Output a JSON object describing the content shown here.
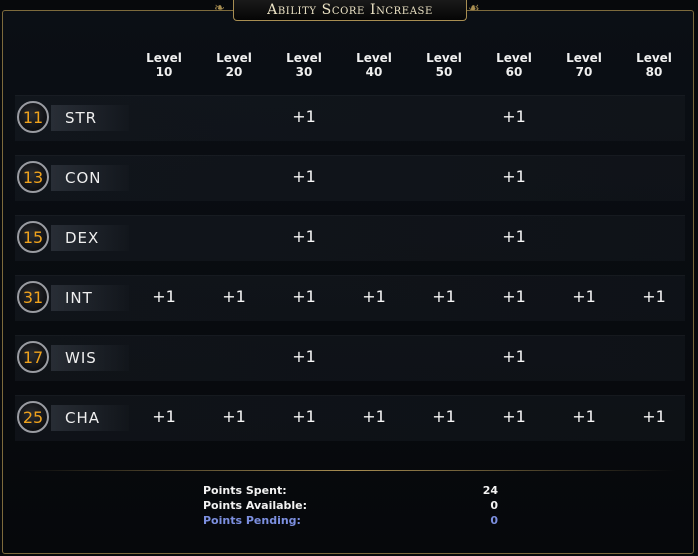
{
  "window": {
    "title": "Ability Score Increase"
  },
  "levels": [
    {
      "label": "Level",
      "num": "10"
    },
    {
      "label": "Level",
      "num": "20"
    },
    {
      "label": "Level",
      "num": "30"
    },
    {
      "label": "Level",
      "num": "40"
    },
    {
      "label": "Level",
      "num": "50"
    },
    {
      "label": "Level",
      "num": "60"
    },
    {
      "label": "Level",
      "num": "70"
    },
    {
      "label": "Level",
      "num": "80"
    }
  ],
  "abilities": [
    {
      "score": "11",
      "abbr": "STR",
      "increases": [
        "",
        "",
        "+1",
        "",
        "",
        "+1",
        "",
        ""
      ]
    },
    {
      "score": "13",
      "abbr": "CON",
      "increases": [
        "",
        "",
        "+1",
        "",
        "",
        "+1",
        "",
        ""
      ]
    },
    {
      "score": "15",
      "abbr": "DEX",
      "increases": [
        "",
        "",
        "+1",
        "",
        "",
        "+1",
        "",
        ""
      ]
    },
    {
      "score": "31",
      "abbr": "INT",
      "increases": [
        "+1",
        "+1",
        "+1",
        "+1",
        "+1",
        "+1",
        "+1",
        "+1"
      ]
    },
    {
      "score": "17",
      "abbr": "WIS",
      "increases": [
        "",
        "",
        "+1",
        "",
        "",
        "+1",
        "",
        ""
      ]
    },
    {
      "score": "25",
      "abbr": "CHA",
      "increases": [
        "+1",
        "+1",
        "+1",
        "+1",
        "+1",
        "+1",
        "+1",
        "+1"
      ]
    }
  ],
  "summary": {
    "spent_label": "Points Spent:",
    "spent_value": "24",
    "available_label": "Points Available:",
    "available_value": "0",
    "pending_label": "Points Pending:",
    "pending_value": "0"
  },
  "colors": {
    "gold_border": "#a88e52",
    "score_orange": "#f0a31d",
    "pending_blue": "#7c8fe0"
  }
}
